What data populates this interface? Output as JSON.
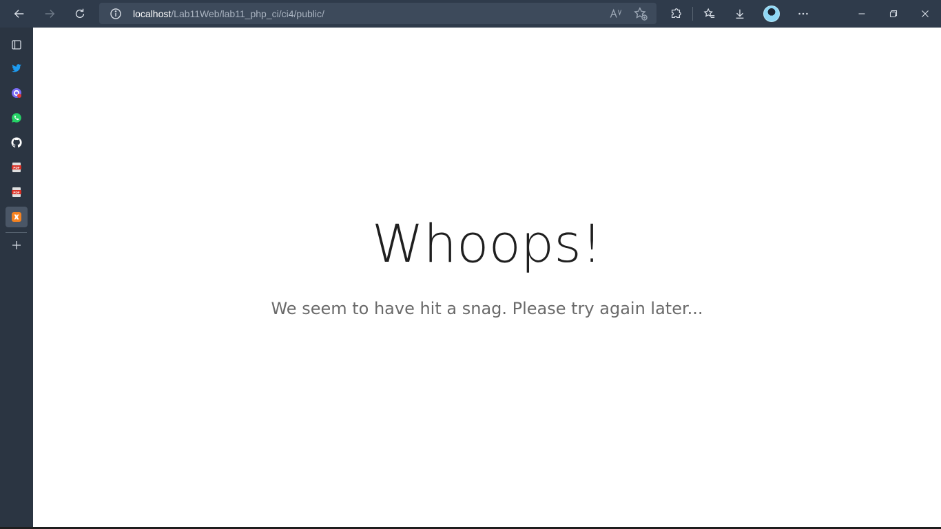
{
  "browser": {
    "address_host": "localhost",
    "address_path": "/Lab11Web/lab11_php_ci/ci4/public/",
    "icons": [
      "back-icon",
      "forward-icon",
      "refresh-icon",
      "info-icon",
      "read-aloud-icon",
      "add-favorite-icon",
      "extensions-icon",
      "favorites-icon",
      "downloads-icon",
      "profile-avatar",
      "more-icon",
      "minimize-icon",
      "restore-icon",
      "close-icon"
    ]
  },
  "sidebar": {
    "items": [
      {
        "name": "tab-actions-icon"
      },
      {
        "name": "twitter-icon"
      },
      {
        "name": "google-icon"
      },
      {
        "name": "whatsapp-icon"
      },
      {
        "name": "github-icon"
      },
      {
        "name": "pdf-icon"
      },
      {
        "name": "pdf-icon"
      },
      {
        "name": "xampp-icon"
      },
      {
        "name": "add-icon"
      }
    ]
  },
  "page": {
    "title": "Whoops!",
    "message": "We seem to have hit a snag. Please try again later..."
  },
  "colors": {
    "toolbar": "#2f3b4b",
    "sidebar": "#2b3542",
    "address_bar": "#3d4a5b",
    "headline": "#1f1f1f",
    "message": "#6a6a6a"
  }
}
